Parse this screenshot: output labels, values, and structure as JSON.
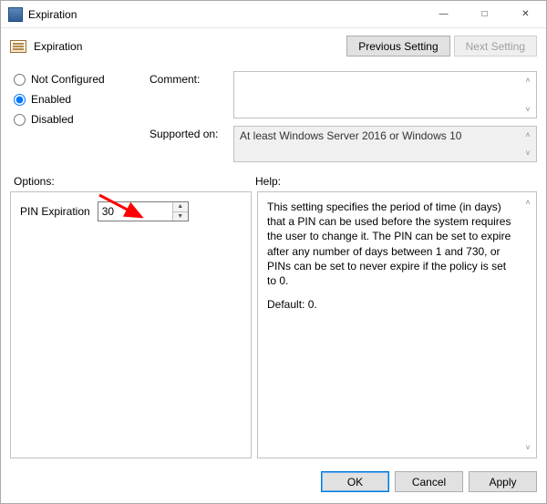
{
  "window": {
    "title": "Expiration"
  },
  "header": {
    "setting_name": "Expiration",
    "prev": "Previous Setting",
    "next": "Next Setting"
  },
  "state": {
    "not_configured": "Not Configured",
    "enabled": "Enabled",
    "disabled": "Disabled",
    "selected": "enabled"
  },
  "labels": {
    "comment": "Comment:",
    "supported": "Supported on:",
    "options": "Options:",
    "help": "Help:"
  },
  "comment": "",
  "supported_on": "At least Windows Server 2016 or Windows 10",
  "options": {
    "pin_expiration_label": "PIN Expiration",
    "pin_expiration_value": "30"
  },
  "help": {
    "p1": "This setting specifies the period of time (in days) that a PIN can be used before the system requires the user to change it. The PIN can be set to expire after any number of days between 1 and 730, or PINs can be set to never expire if the policy is set to 0.",
    "p2": "Default: 0."
  },
  "buttons": {
    "ok": "OK",
    "cancel": "Cancel",
    "apply": "Apply"
  }
}
